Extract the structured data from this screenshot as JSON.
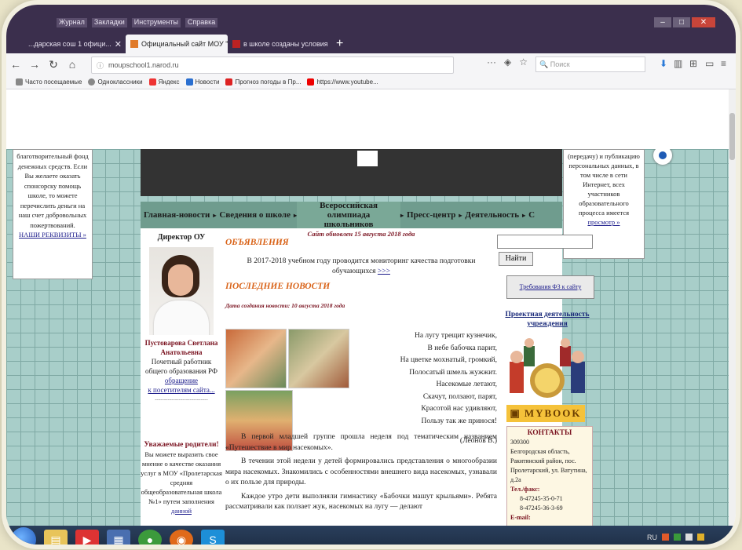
{
  "browser": {
    "menu": [
      "Журнал",
      "Закладки",
      "Инструменты",
      "Справка"
    ],
    "tabs": [
      {
        "label": "...дарская сош 1 офици...",
        "close": "✕"
      },
      {
        "label": "Официальный сайт МОУ \"Пр...",
        "close": "✕"
      },
      {
        "label": "в школе созданы условия д...",
        "close": "✕"
      }
    ],
    "new_tab": "+",
    "url": "moupschool1.narod.ru",
    "search_placeholder": "Поиск",
    "bookmarks": [
      "Часто посещаемые",
      "Одноклассники",
      "Яндекс",
      "Новости",
      "Прогноз погоды в Пр...",
      "https://www.youtube..."
    ]
  },
  "left_box": {
    "text": "благотворительный фонд денежных средств. Если Вы желаете оказать спонсорску помощь школе, то можете перечислить деньги на наш счет добровольных пожертвований.",
    "link": "НАШИ РЕКВИЗИТЫ »"
  },
  "right_box": {
    "text": "(передачу) и публикацию персональных данных, в том числе в сети Интернет, всех участников образовательного процесса имеется",
    "link": "просмотр »"
  },
  "topnav": {
    "items": [
      "Главная-новости",
      "Сведения о школе",
      "Всероссийская олимпиада школьников",
      "Пресс-центр",
      "Деятельность",
      "С"
    ]
  },
  "left_col": {
    "title": "Директор ОУ",
    "name": "Пустоварова Светлана Анатольевна",
    "honor": "Почетный работник общего образования РФ",
    "link": "обращение",
    "link_sub": "к посетителям сайта...",
    "divider": "-----------------------------",
    "parents_title": "Уважаемые родители!",
    "parents_text": "Вы можете выразить свое мнение о качестве оказания услуг в МОУ «Пролетарская средняя общеобразовательная школа №1» путем заполнения",
    "parents_link": "данной"
  },
  "main": {
    "opened": "Сайт обновлен 15 августа 2018 года",
    "ads_title": "ОБЪЯВЛЕНИЯ",
    "ads_text": "В 2017-2018 учебном году проводится мониторинг качества подготовки обучающихся",
    "ads_link": ">>>",
    "news_title": "ПОСЛЕДНИЕ НОВОСТИ",
    "news_date": "Дата создания новости: 10 августа 2018 года",
    "poem": [
      "На лугу трещит кузнечик,",
      "В небе бабочка парит,",
      "На цветке мохнатый, громкий,",
      "Полосатый шмель жужжит.",
      "Насекомые летают,",
      "Скачут, ползают, парят,",
      "Красотой нас удивляют,",
      "Пользу так же принося!"
    ],
    "poem_author": "(Леонов В.)",
    "p1": "В первой младшей группе прошла неделя под тематическим названием «Путешествие в мир насекомых».",
    "p2": "В течении этой недели у детей формировались представления о многообразии мира насекомых. Знакомились с особенностями внешнего вида насекомых, узнавали о их пользе для природы.",
    "p3": "Каждое утро дети выполняли гимнастику «Бабочки машут крыльями». Ребята рассматривали как ползает жук, насекомых на лугу — делают"
  },
  "right_col": {
    "find_button": "Найти",
    "requirements": "Требования ФЗ к сайту",
    "project_title": "Проектная деятельность учреждения",
    "mybook": "MYBOOK",
    "contacts_title": "КОНТАКТЫ",
    "index": "309300",
    "address": "Белгородская область, Ракитянский район, пос. Пролетарский, ул. Ватутина, д.2а",
    "tel_label": "Тел./факс:",
    "tel1": "8-47245-35-0-71",
    "tel2": "8-47245-36-3-69",
    "email_label": "E-mail:"
  },
  "taskbar": {
    "tray_lang": "RU"
  }
}
